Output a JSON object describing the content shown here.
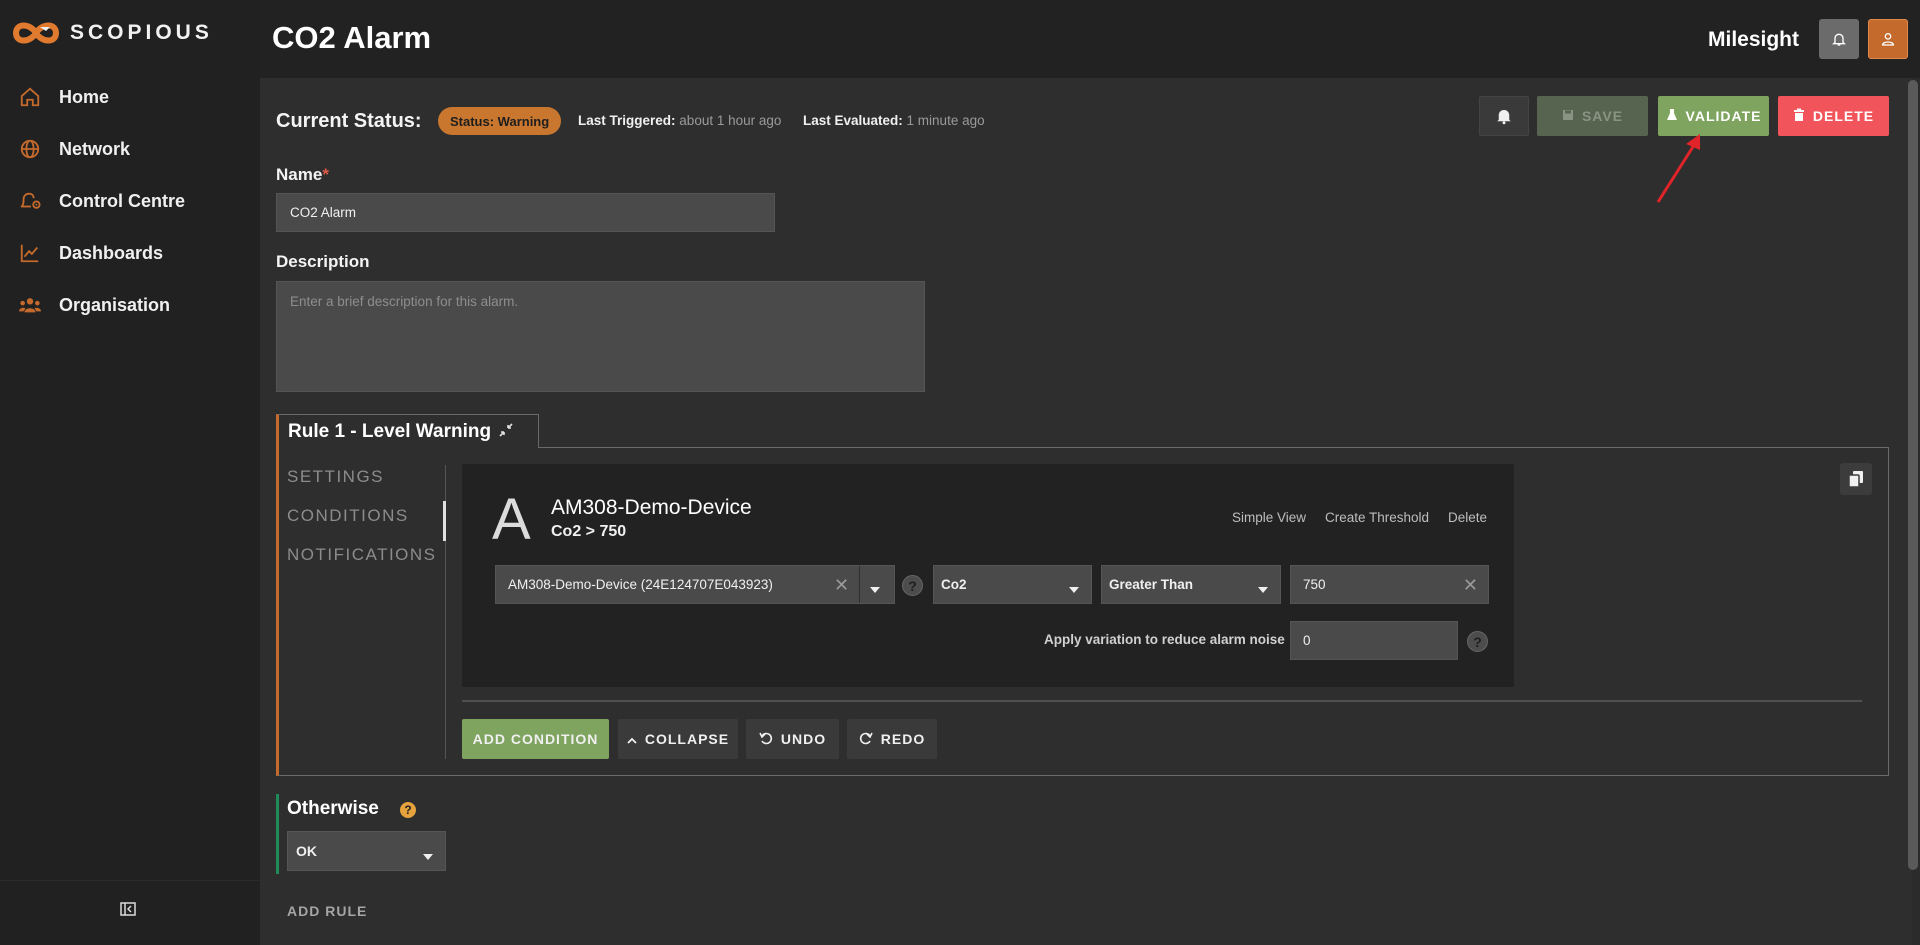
{
  "brand": {
    "name": "SCOPIOUS",
    "accent": "#c46a2c"
  },
  "sidebar": {
    "items": [
      {
        "label": "Home",
        "icon": "home-icon"
      },
      {
        "label": "Network",
        "icon": "globe-icon"
      },
      {
        "label": "Control Centre",
        "icon": "bell-gear-icon"
      },
      {
        "label": "Dashboards",
        "icon": "line-chart-icon"
      },
      {
        "label": "Organisation",
        "icon": "people-icon"
      }
    ],
    "collapse_icon": "collapse-sidebar-icon"
  },
  "header": {
    "title": "CO2 Alarm",
    "org": "Milesight"
  },
  "status": {
    "label": "Current Status:",
    "badge": "Status: Warning",
    "last_triggered_label": "Last Triggered:",
    "last_triggered_value": "about 1 hour ago",
    "last_evaluated_label": "Last Evaluated:",
    "last_evaluated_value": "1 minute ago"
  },
  "actions": {
    "save": "SAVE",
    "validate": "VALIDATE",
    "delete": "DELETE"
  },
  "form": {
    "name_label": "Name",
    "required_mark": "*",
    "name_value": "CO2 Alarm",
    "description_label": "Description",
    "description_placeholder": "Enter a brief description for this alarm."
  },
  "rule": {
    "title": "Rule 1 - Level Warning",
    "nav": [
      "SETTINGS",
      "CONDITIONS",
      "NOTIFICATIONS"
    ],
    "active_nav": "CONDITIONS"
  },
  "condition": {
    "letter": "A",
    "device_name": "AM308-Demo-Device",
    "expression": "Co2 > 750",
    "links": [
      "Simple View",
      "Create Threshold",
      "Delete"
    ],
    "device_select": "AM308-Demo-Device (24E124707E043923)",
    "metric": "Co2",
    "operator": "Greater Than",
    "value": "750",
    "variation_label": "Apply variation to reduce alarm noise",
    "variation_value": "0",
    "help_mark": "?"
  },
  "condition_actions": {
    "add_condition": "ADD CONDITION",
    "collapse": "COLLAPSE",
    "undo": "UNDO",
    "redo": "REDO"
  },
  "otherwise": {
    "title": "Otherwise",
    "help_mark": "?",
    "value": "OK"
  },
  "add_rule": "ADD RULE"
}
